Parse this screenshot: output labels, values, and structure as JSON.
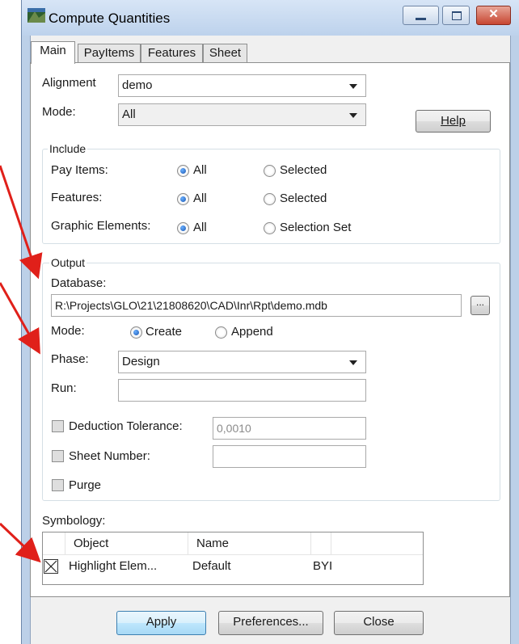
{
  "window": {
    "title": "Compute Quantities",
    "close_glyph": "✕"
  },
  "tabs": [
    {
      "label": "Main"
    },
    {
      "label": "PayItems"
    },
    {
      "label": "Features"
    },
    {
      "label": "Sheet"
    }
  ],
  "main": {
    "alignment_label": "Alignment",
    "alignment_value": "demo",
    "mode_label": "Mode:",
    "mode_value": "All",
    "help_label": "Help",
    "include": {
      "title": "Include",
      "rows": [
        {
          "label": "Pay Items:",
          "opt1": "All",
          "opt2": "Selected"
        },
        {
          "label": "Features:",
          "opt1": "All",
          "opt2": "Selected"
        },
        {
          "label": "Graphic Elements:",
          "opt1": "All",
          "opt2": "Selection Set"
        }
      ]
    },
    "output": {
      "title": "Output",
      "database_label": "Database:",
      "database_value": "R:\\Projects\\GLO\\21\\21808620\\CAD\\Inr\\Rpt\\demo.mdb",
      "browse_label": "...",
      "mode_label": "Mode:",
      "mode_create": "Create",
      "mode_append": "Append",
      "phase_label": "Phase:",
      "phase_value": "Design",
      "run_label": "Run:",
      "run_value": "",
      "deduction_label": "Deduction Tolerance:",
      "deduction_value": "0,0010",
      "sheet_label": "Sheet Number:",
      "sheet_value": "",
      "purge_label": "Purge"
    },
    "symbology": {
      "label": "Symbology:",
      "columns": [
        "Object",
        "Name",
        ""
      ],
      "rows": [
        {
          "object": "Highlight Elem...",
          "name": "Default",
          "extra": "BYI"
        }
      ]
    }
  },
  "footer": {
    "apply_label": "Apply",
    "preferences_label": "Preferences...",
    "close_label": "Close"
  },
  "colors": {
    "annotation_arrow": "#e0201a",
    "title_bar": "#c6d8ef"
  }
}
